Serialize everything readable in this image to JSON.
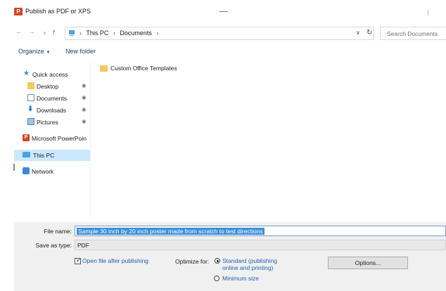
{
  "window": {
    "title": "Publish as PDF or XPS",
    "app_icon": "powerpoint-icon"
  },
  "nav": {
    "back_glyph": "←",
    "forward_glyph": "→",
    "recent_glyph": "∨",
    "up_glyph": "↑",
    "path": [
      "This PC",
      "Documents"
    ],
    "separator": "›",
    "search_placeholder": "Search Documents"
  },
  "toolbar": {
    "organize_label": "Organize",
    "new_folder_label": "New folder"
  },
  "sidebar": {
    "items": [
      {
        "label": "Quick access",
        "icon": "star-icon"
      },
      {
        "label": "Desktop",
        "icon": "folder-icon",
        "pinned": true
      },
      {
        "label": "Documents",
        "icon": "documents-icon",
        "pinned": true
      },
      {
        "label": "Downloads",
        "icon": "download-arrow-icon",
        "pinned": true
      },
      {
        "label": "Pictures",
        "icon": "pictures-icon",
        "pinned": true
      },
      {
        "label": "Microsoft PowerPoin",
        "icon": "powerpoint-icon"
      },
      {
        "label": "This PC",
        "icon": "computer-icon",
        "selected": true
      },
      {
        "label": "Network",
        "icon": "network-icon"
      }
    ]
  },
  "content": {
    "files": [
      {
        "name": "Custom Office Templates",
        "icon": "folder-icon"
      }
    ]
  },
  "form": {
    "file_name_label": "File name:",
    "file_name_value": "Sample 30 inch by 20 inch poster made from scratch to test directions",
    "save_type_label": "Save as type:",
    "save_type_value": "PDF",
    "open_after_label": "Open file after publishing",
    "open_after_checked": true,
    "optimize_label": "Optimize for:",
    "optimize_standard_label": "Standard (publishing online and printing)",
    "optimize_minimum_label": "Minimum size",
    "options_button_label": "Options..."
  },
  "colors": {
    "accent": "#3b8fd6",
    "selection": "#cce8ff",
    "link_text": "#1f5fb0",
    "powerpoint": "#d24726"
  }
}
